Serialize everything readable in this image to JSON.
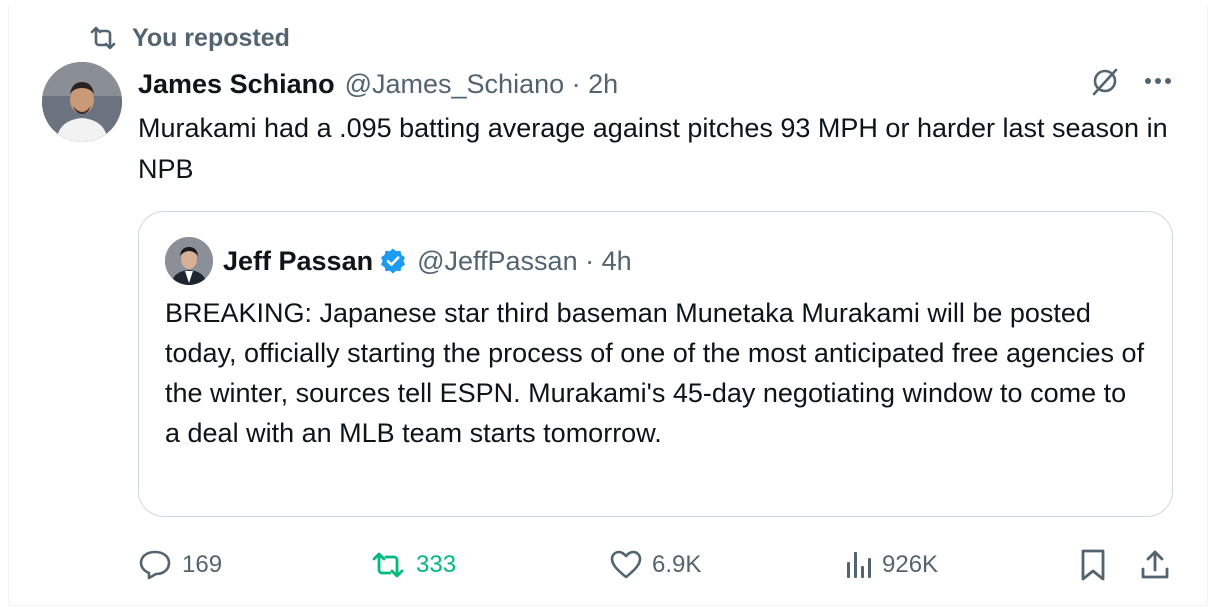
{
  "repost": {
    "label": "You reposted",
    "icon": "repost-icon"
  },
  "tweet": {
    "author_name": "James Schiano",
    "handle_time": "@James_Schiano · 2h",
    "text": "Murakami had a .095 batting average against pitches 93 MPH or harder last season in NPB"
  },
  "quote": {
    "author_name": "Jeff Passan",
    "handle_time": "@JeffPassan · 4h",
    "text": "BREAKING: Japanese star third baseman Munetaka Murakami will be posted today, officially starting the process of one of the most anticipated free agencies of the winter, sources tell ESPN. Murakami's 45-day negotiating window to come to a deal with an MLB team starts tomorrow."
  },
  "stats": {
    "replies": "169",
    "reposts": "333",
    "likes": "6.9K",
    "views": "926K"
  },
  "colors": {
    "text": "#0f1419",
    "muted": "#536471",
    "repost_active": "#00ba7c",
    "verified": "#1d9bf0",
    "border": "#cfd9de"
  }
}
